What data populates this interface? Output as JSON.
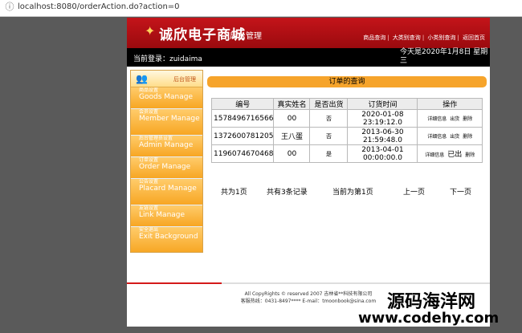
{
  "browser": {
    "url": "localhost:8080/orderAction.do?action=0"
  },
  "header": {
    "logo_text": "诚欣电子商城",
    "logo_sub": "后台管理",
    "nav": [
      "商品查询",
      "大类别查询",
      "小类别查询",
      "返回首页"
    ]
  },
  "userbar": {
    "login_text": "当前登录：zuidaima",
    "date_text": "今天是2020年1月8日 星期三"
  },
  "sidebar": {
    "title": "后台管理",
    "items": [
      {
        "cn": "商品设置",
        "en": "Goods Manage"
      },
      {
        "cn": "会员设置",
        "en": "Member Manage"
      },
      {
        "cn": "后台管理员设置",
        "en": "Admin Manage"
      },
      {
        "cn": "订单设置",
        "en": "Order Manage"
      },
      {
        "cn": "公告设置",
        "en": "Placard Manage"
      },
      {
        "cn": "友链设置",
        "en": "Link Manage"
      },
      {
        "cn": "安全退出",
        "en": "Exit Background"
      }
    ]
  },
  "main": {
    "title": "订单的查询",
    "columns": [
      "编号",
      "真实姓名",
      "是否出货",
      "订货时间",
      "操作"
    ],
    "rows": [
      {
        "id": "1578496716566",
        "name": "00",
        "shipped": "否",
        "date": "2020-01-08",
        "time": "23:19:12.0",
        "op1": "详细信息",
        "op2": "出货",
        "op3": "删除"
      },
      {
        "id": "1372600781205",
        "name": "王八蛋",
        "shipped": "否",
        "date": "2013-06-30",
        "time": "21:59:48.0",
        "op1": "详细信息",
        "op2": "出货",
        "op3": "删除"
      },
      {
        "id": "1196074670468",
        "name": "00",
        "shipped": "是",
        "date": "2013-04-01",
        "time": "00:00:00.0",
        "op1": "详细信息",
        "op2": "已出",
        "op3": "删除"
      }
    ],
    "pager": {
      "total_pages": "共为1页",
      "total_records": "共有3条记录",
      "current": "当前为第1页",
      "prev": "上一页",
      "next": "下一页"
    }
  },
  "footer": {
    "line1": "All CopyRights © reserved 2007 吉林省**科技有限公司",
    "line2": "客服热线：0431-8497**** E-mail：tmoonbook@sina.com"
  },
  "watermark": {
    "cn": "源码海洋网",
    "url": "www.codehy.com"
  }
}
